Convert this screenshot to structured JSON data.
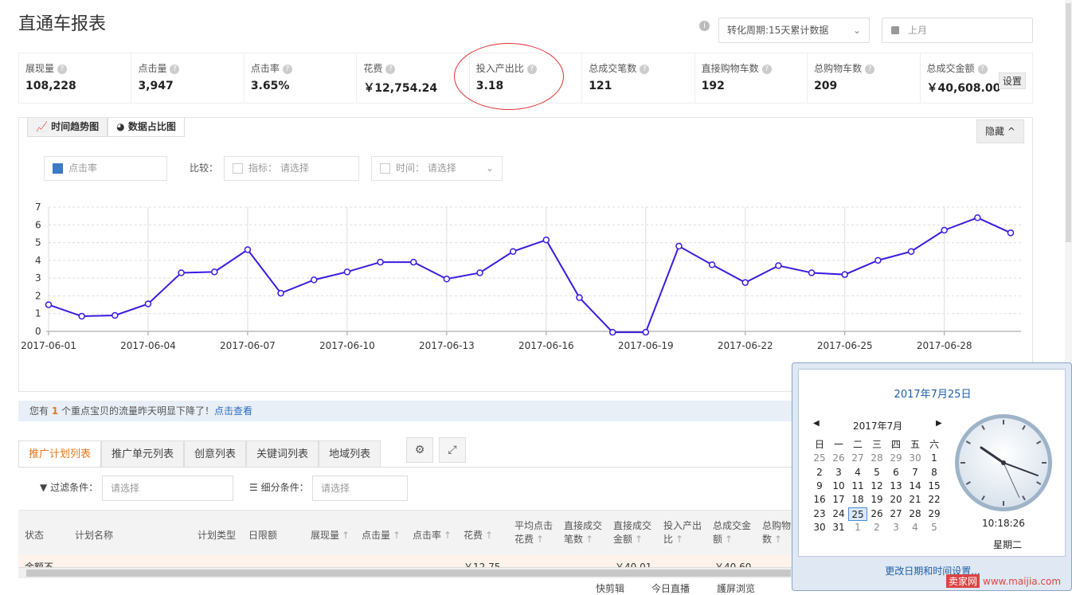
{
  "page": {
    "title": "直通车报表",
    "period_select": "转化周期:15天累计数据",
    "date_placeholder": "上月"
  },
  "metrics": [
    {
      "label": "展现量",
      "value": "108,228"
    },
    {
      "label": "点击量",
      "value": "3,947"
    },
    {
      "label": "点击率",
      "value": "3.65%"
    },
    {
      "label": "花费",
      "value": "￥12,754.24"
    },
    {
      "label": "投入产出比",
      "value": "3.18"
    },
    {
      "label": "总成交笔数",
      "value": "121"
    },
    {
      "label": "直接购物车数",
      "value": "192"
    },
    {
      "label": "总购物车数",
      "value": "209"
    },
    {
      "label": "总成交金额",
      "value": "￥40,608.00"
    }
  ],
  "metrics_setting": "设置",
  "chart_panel": {
    "tab_trend": "时间趋势图",
    "tab_ratio": "数据占比图",
    "hide": "隐藏",
    "metric_picker": "点击率",
    "compare_label": "比较：",
    "indicator_label": "指标：",
    "indicator_placeholder": "请选择",
    "time_label": "时间：",
    "time_placeholder": "请选择"
  },
  "chart_data": {
    "type": "line",
    "x": [
      "2017-06-01",
      "2017-06-02",
      "2017-06-03",
      "2017-06-04",
      "2017-06-05",
      "2017-06-06",
      "2017-06-07",
      "2017-06-08",
      "2017-06-09",
      "2017-06-10",
      "2017-06-11",
      "2017-06-12",
      "2017-06-13",
      "2017-06-14",
      "2017-06-15",
      "2017-06-16",
      "2017-06-17",
      "2017-06-18",
      "2017-06-19",
      "2017-06-20",
      "2017-06-21",
      "2017-06-22",
      "2017-06-23",
      "2017-06-24",
      "2017-06-25",
      "2017-06-26",
      "2017-06-27",
      "2017-06-28",
      "2017-06-29",
      "2017-06-30"
    ],
    "x_tick_labels": [
      "2017-06-01",
      "2017-06-04",
      "2017-06-07",
      "2017-06-10",
      "2017-06-13",
      "2017-06-16",
      "2017-06-19",
      "2017-06-22",
      "2017-06-25",
      "2017-06-28"
    ],
    "series": [
      {
        "name": "点击率",
        "values": [
          1.5,
          0.85,
          0.9,
          1.55,
          3.3,
          3.35,
          4.6,
          2.15,
          2.9,
          3.35,
          3.9,
          3.9,
          2.95,
          3.3,
          4.5,
          5.15,
          1.9,
          -0.05,
          -0.05,
          4.8,
          3.75,
          2.75,
          3.7,
          3.3,
          3.2,
          4.0,
          4.5,
          5.7,
          6.4,
          5.55
        ]
      }
    ],
    "y_ticks": [
      0,
      1,
      2,
      3,
      4,
      5,
      6,
      7
    ],
    "ylim": [
      0,
      7
    ],
    "grid": true,
    "line_color": "#3a1be0"
  },
  "alert": {
    "prefix": "您有",
    "count": "1",
    "middle": "个重点宝贝的流量昨天明显下降了！",
    "link": "点击查看"
  },
  "list_tabs": [
    "推广计划列表",
    "推广单元列表",
    "创意列表",
    "关键词列表",
    "地域列表"
  ],
  "filters": {
    "filter_label": "过滤条件：",
    "filter_placeholder": "请选择",
    "breakdown_label": "细分条件：",
    "breakdown_placeholder": "请选择"
  },
  "table": {
    "headers": {
      "status": "状态",
      "plan_name": "计划名称",
      "plan_type": "计划类型",
      "daily_budget": "日限额",
      "impressions": "展现量",
      "clicks": "点击量",
      "ctr": "点击率",
      "cost": "花费",
      "avg_click_1": "平均点击",
      "avg_click_2": "花费",
      "direct_orders_1": "直接成交",
      "direct_orders_2": "笔数",
      "direct_amount_1": "直接成交",
      "direct_amount_2": "金额",
      "roi_1": "投入产出",
      "roi_2": "比",
      "total_amount_1": "总成交金",
      "total_amount_2": "额",
      "total_cart_1": "总购物",
      "total_cart_2": "数"
    },
    "row": {
      "status": "余额不",
      "cost": "￥12.75",
      "direct_amount": "￥40.01",
      "total_amount": "￥40.60"
    }
  },
  "taskbar": {
    "item1": "快剪辑",
    "item2": "今日直播",
    "item3": "護屏浏览"
  },
  "clock": {
    "date_title": "2017年7月25日",
    "month": "2017年7月",
    "weekdays": [
      "日",
      "一",
      "二",
      "三",
      "四",
      "五",
      "六"
    ],
    "days": [
      [
        "25",
        "26",
        "27",
        "28",
        "29",
        "30",
        "1"
      ],
      [
        "2",
        "3",
        "4",
        "5",
        "6",
        "7",
        "8"
      ],
      [
        "9",
        "10",
        "11",
        "12",
        "13",
        "14",
        "15"
      ],
      [
        "16",
        "17",
        "18",
        "19",
        "20",
        "21",
        "22"
      ],
      [
        "23",
        "24",
        "25",
        "26",
        "27",
        "28",
        "29"
      ],
      [
        "30",
        "31",
        "1",
        "2",
        "3",
        "4",
        "5"
      ]
    ],
    "time": "10:18:26",
    "weekday": "星期二",
    "settings_link": "更改日期和时间设置..."
  },
  "watermark": {
    "box": "卖家网",
    "text": "www.maijia.com"
  }
}
